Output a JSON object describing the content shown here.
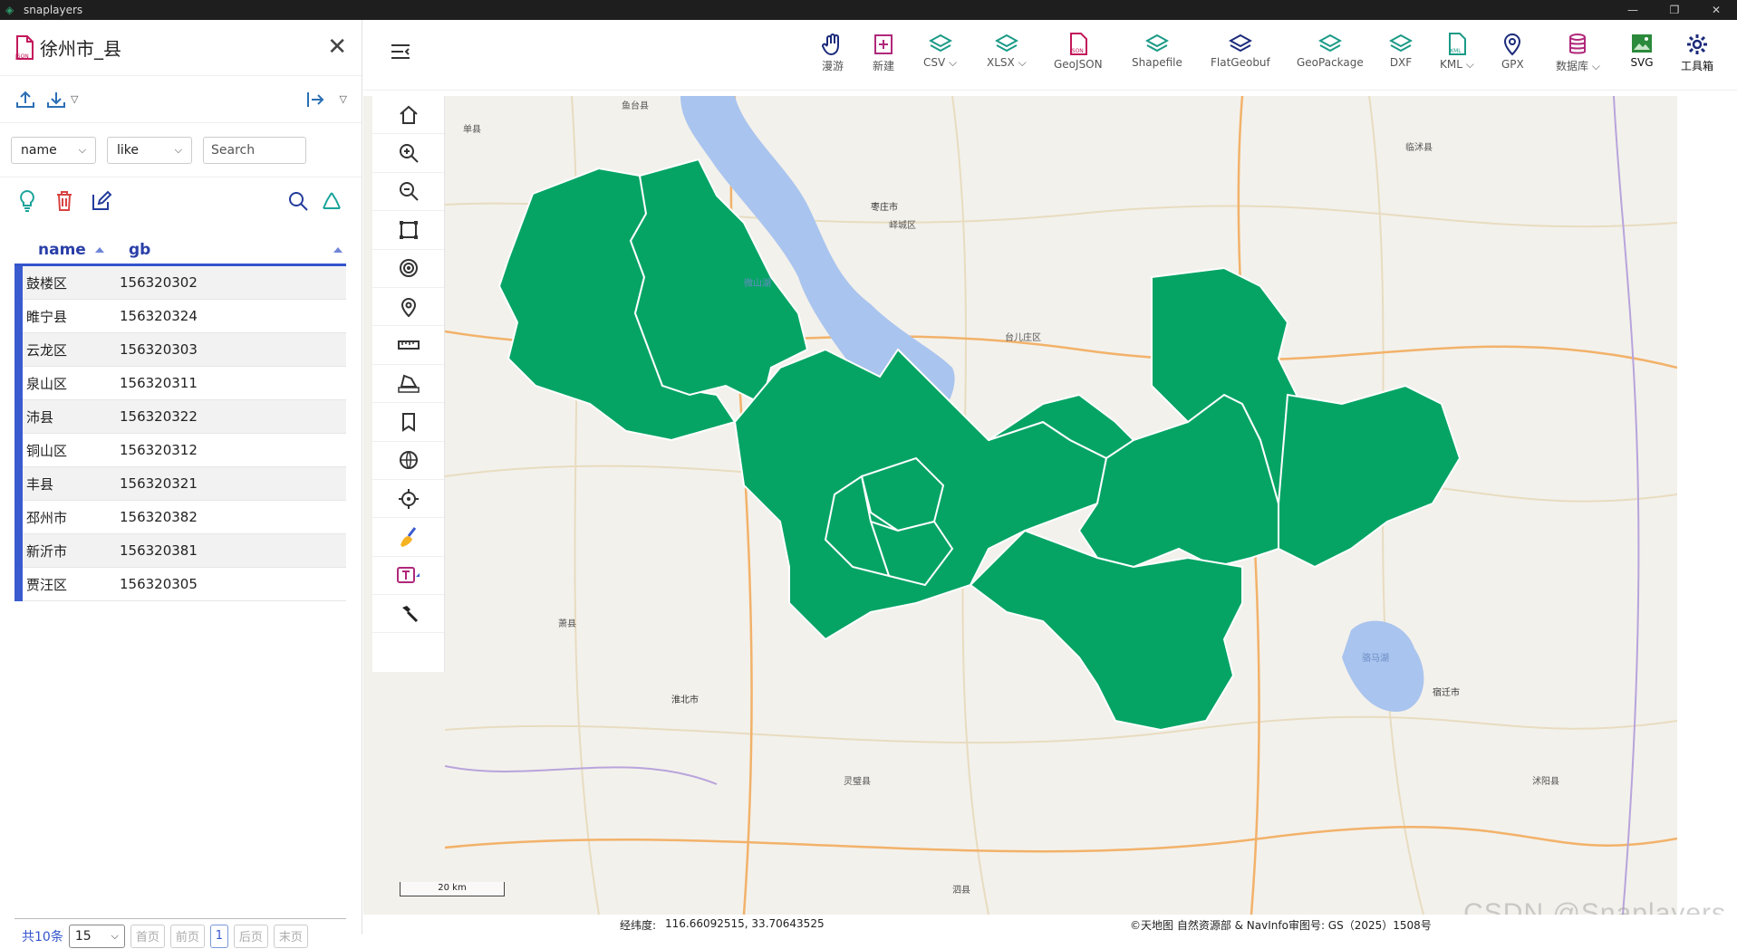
{
  "window": {
    "app_name": "snaplayers"
  },
  "layer_panel": {
    "title": "徐州市_县",
    "filter": {
      "field": "name",
      "operator": "like",
      "search_placeholder": "Search"
    },
    "table": {
      "columns": [
        "name",
        "gb"
      ],
      "rows": [
        {
          "name": "鼓楼区",
          "gb": "156320302"
        },
        {
          "name": "睢宁县",
          "gb": "156320324"
        },
        {
          "name": "云龙区",
          "gb": "156320303"
        },
        {
          "name": "泉山区",
          "gb": "156320311"
        },
        {
          "name": "沛县",
          "gb": "156320322"
        },
        {
          "name": "铜山区",
          "gb": "156320312"
        },
        {
          "name": "丰县",
          "gb": "156320321"
        },
        {
          "name": "邳州市",
          "gb": "156320382"
        },
        {
          "name": "新沂市",
          "gb": "156320381"
        },
        {
          "name": "贾汪区",
          "gb": "156320305"
        }
      ]
    },
    "pager": {
      "count_label": "共10条",
      "page_size": "15",
      "first": "首页",
      "prev": "前页",
      "current": "1",
      "next": "后页",
      "last": "末页"
    }
  },
  "toolbar": {
    "items": [
      {
        "label": "漫游",
        "icon": "hand-icon"
      },
      {
        "label": "新建",
        "icon": "new-icon"
      },
      {
        "label": "CSV",
        "icon": "layers-icon",
        "dropdown": true
      },
      {
        "label": "XLSX",
        "icon": "layers-icon",
        "dropdown": true
      },
      {
        "label": "GeoJSON",
        "icon": "json-file-icon"
      },
      {
        "label": "Shapefile",
        "icon": "layers-icon"
      },
      {
        "label": "FlatGeobuf",
        "icon": "layers-icon"
      },
      {
        "label": "GeoPackage",
        "icon": "layers-icon"
      },
      {
        "label": "DXF",
        "icon": "layers-icon"
      },
      {
        "label": "KML",
        "icon": "kml-file-icon",
        "dropdown": true
      },
      {
        "label": "GPX",
        "icon": "pin-icon"
      },
      {
        "label": "数据库",
        "icon": "database-icon",
        "dropdown": true
      },
      {
        "label": "SVG",
        "icon": "image-icon"
      },
      {
        "label": "工具箱",
        "icon": "gear-icon"
      }
    ]
  },
  "map": {
    "fill_color": "#05a465",
    "water_color": "#a9c4ee",
    "scale_label": "20 km",
    "place_labels": [
      "微山湖",
      "骆马湖",
      "枣庄市",
      "宿迁市",
      "淮北市",
      "萧县",
      "鱼台县",
      "单县",
      "峄城区",
      "台儿庄区",
      "临沭县",
      "沭阳县",
      "泗县",
      "灵璧县"
    ]
  },
  "status": {
    "coord_label": "经纬度:",
    "coord_value": "116.66092515, 33.70643525",
    "attribution": "©天地图 自然资源部 & NavInfo审图号: GS（2025）1508号"
  },
  "watermark": "CSDN @Snaplayers"
}
